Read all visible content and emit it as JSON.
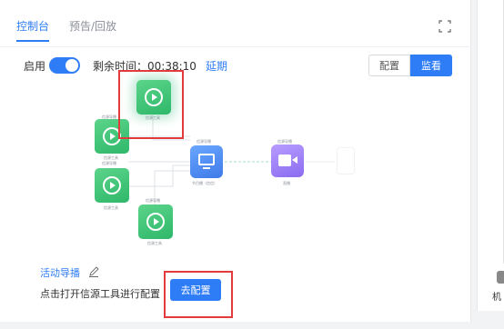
{
  "tabs": {
    "console": "控制台",
    "preview": "预告/回放"
  },
  "controls": {
    "enable_label": "启用",
    "toggle_on": true,
    "remaining": "剩余时间：00:38:10",
    "extend": "延期",
    "segment": {
      "config": "配置",
      "monitor": "监看"
    }
  },
  "graph": {
    "src_label": "信源工具",
    "src_title": "信源导播",
    "pc_title": "信源导播",
    "pc_label": "节目播（信信）",
    "video_title": "信源导播",
    "video_label": "直播",
    "colors": {
      "source": "#2fb86a",
      "pc": "#3f7be8",
      "video": "#8a6cf0",
      "highlight": "#e23b3b"
    }
  },
  "footer": {
    "activity": "活动导播",
    "hint": "点击打开信源工具进行配置",
    "config_button": "去配置"
  },
  "side": {
    "label": "机"
  }
}
